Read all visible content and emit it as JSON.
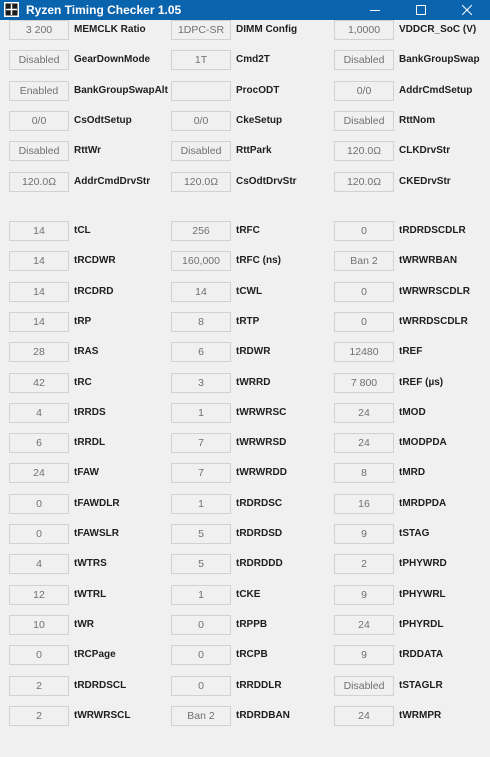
{
  "window": {
    "title": "Ryzen Timing Checker 1.05",
    "titlebar_color": "#0a64ad"
  },
  "config_rows": [
    [
      [
        "3 200",
        "MEMCLK Ratio"
      ],
      [
        "1DPC-SR",
        "DIMM Config"
      ],
      [
        "1,0000",
        "VDDCR_SoC (V)"
      ]
    ],
    [
      [
        "Disabled",
        "GearDownMode"
      ],
      [
        "1T",
        "Cmd2T"
      ],
      [
        "Disabled",
        "BankGroupSwap"
      ]
    ],
    [
      [
        "Enabled",
        "BankGroupSwapAlt"
      ],
      [
        "",
        "ProcODT"
      ],
      [
        "0/0",
        "AddrCmdSetup"
      ]
    ],
    [
      [
        "0/0",
        "CsOdtSetup"
      ],
      [
        "0/0",
        "CkeSetup"
      ],
      [
        "Disabled",
        "RttNom"
      ]
    ],
    [
      [
        "Disabled",
        "RttWr"
      ],
      [
        "Disabled",
        "RttPark"
      ],
      [
        "120.0Ω",
        "CLKDrvStr"
      ]
    ],
    [
      [
        "120.0Ω",
        "AddrCmdDrvStr"
      ],
      [
        "120.0Ω",
        "CsOdtDrvStr"
      ],
      [
        "120.0Ω",
        "CKEDrvStr"
      ]
    ]
  ],
  "timing_rows": [
    [
      [
        "14",
        "tCL"
      ],
      [
        "256",
        "tRFC"
      ],
      [
        "0",
        "tRDRDSCDLR"
      ]
    ],
    [
      [
        "14",
        "tRCDWR"
      ],
      [
        "160,000",
        "tRFC (ns)"
      ],
      [
        "Ban 2",
        "tWRWRBAN"
      ]
    ],
    [
      [
        "14",
        "tRCDRD"
      ],
      [
        "14",
        "tCWL"
      ],
      [
        "0",
        "tWRWRSCDLR"
      ]
    ],
    [
      [
        "14",
        "tRP"
      ],
      [
        "8",
        "tRTP"
      ],
      [
        "0",
        "tWRRDSCDLR"
      ]
    ],
    [
      [
        "28",
        "tRAS"
      ],
      [
        "6",
        "tRDWR"
      ],
      [
        "12480",
        "tREF"
      ]
    ],
    [
      [
        "42",
        "tRC"
      ],
      [
        "3",
        "tWRRD"
      ],
      [
        "7 800",
        "tREF (µs)"
      ]
    ],
    [
      [
        "4",
        "tRRDS"
      ],
      [
        "1",
        "tWRWRSC"
      ],
      [
        "24",
        "tMOD"
      ]
    ],
    [
      [
        "6",
        "tRRDL"
      ],
      [
        "7",
        "tWRWRSD"
      ],
      [
        "24",
        "tMODPDA"
      ]
    ],
    [
      [
        "24",
        "tFAW"
      ],
      [
        "7",
        "tWRWRDD"
      ],
      [
        "8",
        "tMRD"
      ]
    ],
    [
      [
        "0",
        "tFAWDLR"
      ],
      [
        "1",
        "tRDRDSC"
      ],
      [
        "16",
        "tMRDPDA"
      ]
    ],
    [
      [
        "0",
        "tFAWSLR"
      ],
      [
        "5",
        "tRDRDSD"
      ],
      [
        "9",
        "tSTAG"
      ]
    ],
    [
      [
        "4",
        "tWTRS"
      ],
      [
        "5",
        "tRDRDDD"
      ],
      [
        "2",
        "tPHYWRD"
      ]
    ],
    [
      [
        "12",
        "tWTRL"
      ],
      [
        "1",
        "tCKE"
      ],
      [
        "9",
        "tPHYWRL"
      ]
    ],
    [
      [
        "10",
        "tWR"
      ],
      [
        "0",
        "tRPPB"
      ],
      [
        "24",
        "tPHYRDL"
      ]
    ],
    [
      [
        "0",
        "tRCPage"
      ],
      [
        "0",
        "tRCPB"
      ],
      [
        "9",
        "tRDDATA"
      ]
    ],
    [
      [
        "2",
        "tRDRDSCL"
      ],
      [
        "0",
        "tRRDDLR"
      ],
      [
        "Disabled",
        "tSTAGLR"
      ]
    ],
    [
      [
        "2",
        "tWRWRSCL"
      ],
      [
        "Ban 2",
        "tRDRDBAN"
      ],
      [
        "24",
        "tWRMPR"
      ]
    ]
  ]
}
